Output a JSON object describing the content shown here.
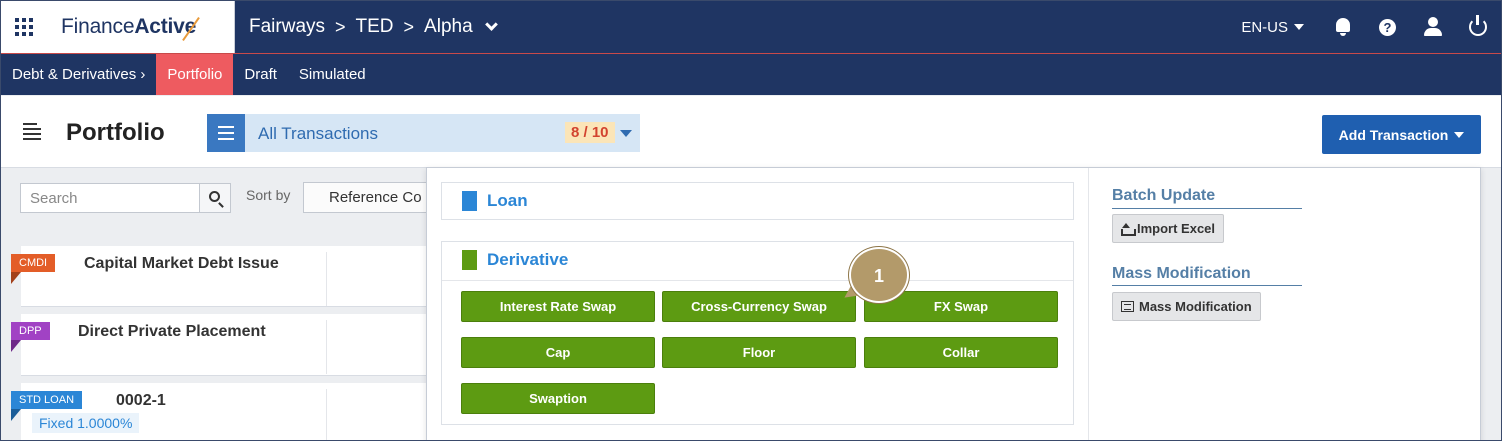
{
  "app": {
    "logo_regular": "Finance",
    "logo_bold": "Active",
    "breadcrumb": [
      "Fairways",
      "TED",
      "Alpha"
    ]
  },
  "topbar": {
    "language": "EN-US",
    "icons": [
      "bell-icon",
      "help-icon",
      "user-icon",
      "power-icon"
    ],
    "help_glyph": "?"
  },
  "subnav": {
    "items": [
      {
        "label": "Debt & Derivatives ›",
        "active": false
      },
      {
        "label": "Portfolio",
        "active": true
      },
      {
        "label": "Draft",
        "active": false
      },
      {
        "label": "Simulated",
        "active": false
      }
    ]
  },
  "header": {
    "title": "Portfolio",
    "selector_label": "All Transactions",
    "selector_count": "8 / 10",
    "add_button": "Add Transaction"
  },
  "toolbar": {
    "search_placeholder": "Search",
    "sort_label": "Sort by",
    "sort_value": "Reference Co"
  },
  "cards": [
    {
      "tag": "CMDI",
      "title": "Capital Market Debt Issue",
      "color": "#e35d28"
    },
    {
      "tag": "DPP",
      "title": "Direct Private Placement",
      "color": "#a142c4"
    },
    {
      "tag": "STD LOAN",
      "title": "0002-1",
      "rate": "Fixed 1.0000%",
      "color": "#2b86d6"
    }
  ],
  "panel": {
    "loan_title": "Loan",
    "derivative_title": "Derivative",
    "derivatives": [
      "Interest Rate Swap",
      "Cross-Currency Swap",
      "FX Swap",
      "Cap",
      "Floor",
      "Collar",
      "Swaption"
    ],
    "batch_update_title": "Batch Update",
    "import_excel": "Import Excel",
    "mass_mod_title": "Mass Modification",
    "mass_mod_button": "Mass Modification",
    "callout_number": "1"
  },
  "colors": {
    "navy": "#1f3563",
    "active_tab": "#ee5b60",
    "primary": "#1f5fb0",
    "derivative_green": "#5d9b12",
    "loan_blue": "#2b86d6"
  }
}
